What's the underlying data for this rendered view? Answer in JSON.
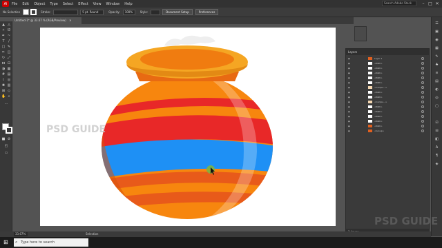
{
  "app": {
    "logo": "Ai"
  },
  "menubar": {
    "items": [
      "File",
      "Edit",
      "Object",
      "Type",
      "Select",
      "Effect",
      "View",
      "Window",
      "Help"
    ],
    "search_placeholder": "Search Adobe Stock",
    "window_controls": [
      "–",
      "□",
      "✕"
    ]
  },
  "controlbar": {
    "selection": "No Selection",
    "stroke_label": "Stroke:",
    "brush": "5 pt. Round",
    "opacity_label": "Opacity:",
    "opacity_value": "100%",
    "style_label": "Style:",
    "doc_setup": "Document Setup",
    "preferences": "Preferences"
  },
  "document": {
    "tab_title": "Untitled-1* @ 33.67 % (RGB/Preview)",
    "close": "✕"
  },
  "canvas": {
    "watermark_left": "PSD GUIDE",
    "watermark_right": "PSD GUIDE",
    "artwork": "clay pot illustration",
    "colors": {
      "body": "#F7860E",
      "red_band": "#E82828",
      "blue_band": "#1E90F5",
      "rim": "#F5A623",
      "shadow": "#D9540A",
      "cursor": "#7CB342"
    }
  },
  "layers": {
    "title": "Layers",
    "rows": [
      {
        "name": "Layer 1",
        "thumb": "#e06020"
      },
      {
        "name": "<Path>",
        "thumb": "#ffffff"
      },
      {
        "name": "<Path>",
        "thumb": "#ffffff"
      },
      {
        "name": "<Path>",
        "thumb": "#ffffff"
      },
      {
        "name": "<Path>",
        "thumb": "#ffffff"
      },
      {
        "name": "<Path>",
        "thumb": "#ffffff"
      },
      {
        "name": "<Compo...>",
        "thumb": "#f3d6b0"
      },
      {
        "name": "<Path>",
        "thumb": "#ffffff"
      },
      {
        "name": "<Path>",
        "thumb": "#ffffff"
      },
      {
        "name": "<Compo...>",
        "thumb": "#f3d6b0"
      },
      {
        "name": "<Path>",
        "thumb": "#ffffff"
      },
      {
        "name": "<Path>",
        "thumb": "#ffffff"
      },
      {
        "name": "<Path>",
        "thumb": "#ffffff"
      },
      {
        "name": "<Path>",
        "thumb": "#ffffff"
      },
      {
        "name": "<Path>",
        "thumb": "#e06020"
      },
      {
        "name": "<Group>",
        "thumb": "#e06020"
      }
    ],
    "footer": "1 Layer"
  },
  "statusbar": {
    "zoom": "33.67%",
    "tool": "Selection"
  },
  "taskbar": {
    "search_placeholder": "Type here to search"
  }
}
